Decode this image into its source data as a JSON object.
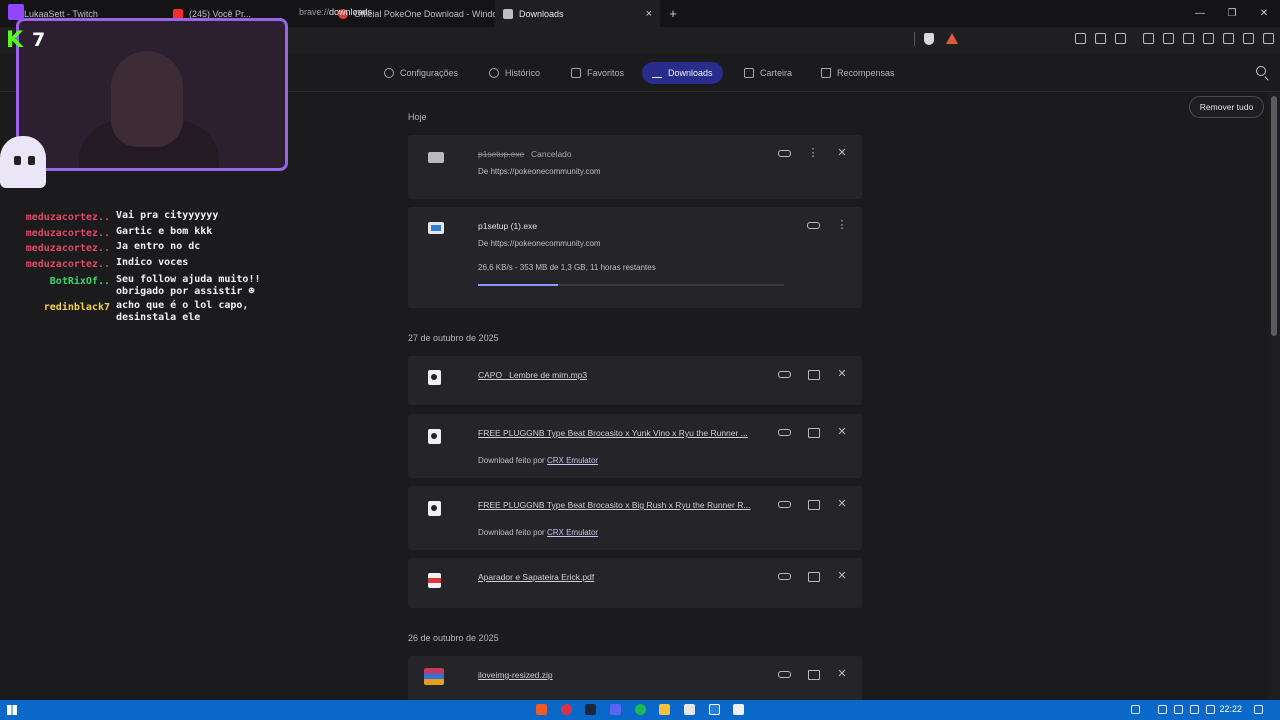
{
  "tabs": [
    {
      "label": "LukaaSett - Twitch",
      "color": "#9146ff"
    },
    {
      "label": "(245) Você Pr...",
      "color": "#ff2a2a"
    },
    {
      "label": "Official PokeOne Download - Windo",
      "color": "#e03a3a"
    },
    {
      "label": "Downloads",
      "color": "#bdbdc4",
      "active": true
    }
  ],
  "browser": {
    "url_scheme": "brave://",
    "url_path": "downloads",
    "new_tab": "+",
    "close": "×"
  },
  "nav": [
    {
      "label": "Configurações",
      "icon": "gear-icon"
    },
    {
      "label": "Histórico",
      "icon": "history-icon"
    },
    {
      "label": "Favoritos",
      "icon": "bookmark-icon"
    },
    {
      "label": "Downloads",
      "icon": "download-icon",
      "active": true
    },
    {
      "label": "Carteira",
      "icon": "wallet-icon"
    },
    {
      "label": "Recompensas",
      "icon": "rewards-icon"
    }
  ],
  "remove_all": "Remover tudo",
  "groups": {
    "today": "Hoje",
    "oct27": "27 de outubro de 2025",
    "oct26": "26 de outubro de 2025"
  },
  "downloads": {
    "cancelled": {
      "name": "p1setup.exe",
      "status": "Cancelado",
      "source": "De https://pokeonecommunity.com"
    },
    "active": {
      "name": "p1setup (1).exe",
      "source": "De https://pokeonecommunity.com",
      "progress_text": "26,6 KB/s - 353 MB de 1,3 GB, 11 horas restantes",
      "progress": 0.26
    },
    "mp3": {
      "name": "CAPO_ Lembre de mim.mp3"
    },
    "beat1": {
      "name": "FREE PLUGGNB Type Beat Brocasito x Yunk Vino x Ryu the Runner ...",
      "by_prefix": "Download feito por",
      "by_link": "CRX Emulator"
    },
    "beat2": {
      "name": "FREE PLUGGNB Type Beat Brocasito x Big Rush x Ryu the Runner R...",
      "by_prefix": "Download feito por",
      "by_link": "CRX Emulator"
    },
    "pdf": {
      "name": "Aparador e Sapateira Erick.pdf"
    },
    "zip": {
      "name": "iloveimg-resized.zip"
    }
  },
  "overlay": {
    "kick_letter": "K",
    "kick_count": "7",
    "chat": [
      {
        "user": "meduzacortez..",
        "msg": "Vai pra cityyyyyy",
        "color": "red"
      },
      {
        "user": "meduzacortez..",
        "msg": "Gartic e bom kkk",
        "color": "red"
      },
      {
        "user": "meduzacortez..",
        "msg": "Ja entro no dc",
        "color": "red"
      },
      {
        "user": "meduzacortez..",
        "msg": "Indico voces",
        "color": "red"
      },
      {
        "user": "BotRixOf..",
        "msg": "Seu follow ajuda muito!! obrigado por assistir ☻",
        "color": "green"
      },
      {
        "user": "redinblack7",
        "msg": "acho que é o lol capo, desinstala ele",
        "color": "yellow"
      }
    ]
  },
  "taskbar": {
    "time": "22:22"
  }
}
